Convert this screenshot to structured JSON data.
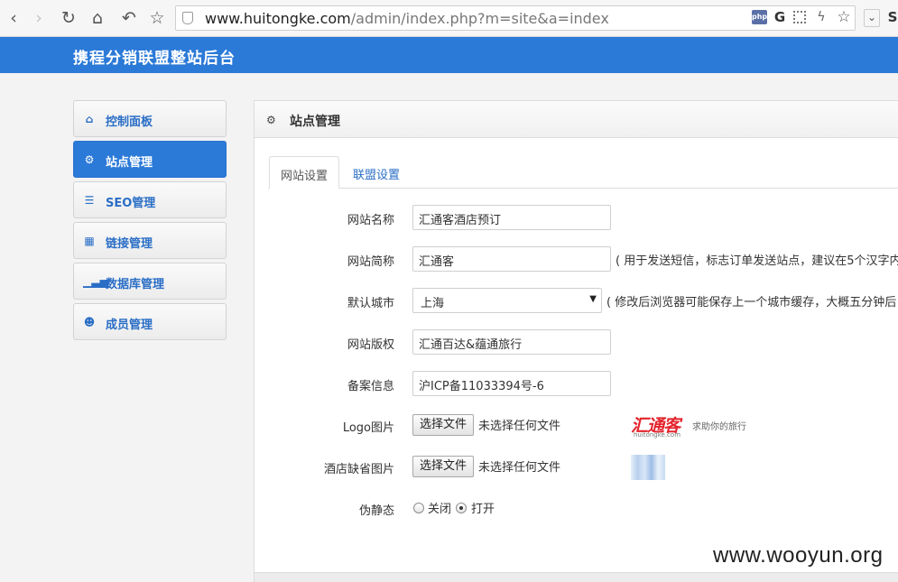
{
  "browser": {
    "url_host": "www.huitongke.com",
    "url_path": "/admin/index.php?m=site&a=index",
    "ext_php": "php",
    "ext_g": "G",
    "ext_s": "S"
  },
  "header": {
    "title": "携程分销联盟整站后台"
  },
  "sidebar": {
    "items": [
      {
        "label": "控制面板",
        "icon": "home-icon",
        "active": false
      },
      {
        "label": "站点管理",
        "icon": "cogs-icon",
        "active": true
      },
      {
        "label": "SEO管理",
        "icon": "list-icon",
        "active": false
      },
      {
        "label": "链接管理",
        "icon": "grid-icon",
        "active": false
      },
      {
        "label": "数据库管理",
        "icon": "signal-icon",
        "active": false
      },
      {
        "label": "成员管理",
        "icon": "user-icon",
        "active": false
      }
    ]
  },
  "panel": {
    "title": "站点管理",
    "tabs": [
      {
        "label": "网站设置",
        "active": true
      },
      {
        "label": "联盟设置",
        "active": false
      }
    ],
    "form": {
      "site_name": {
        "label": "网站名称",
        "value": "汇通客酒店预订"
      },
      "short_name": {
        "label": "网站简称",
        "value": "汇通客",
        "hint": "( 用于发送短信，标志订单发送站点，建议在5个汉字内"
      },
      "default_city": {
        "label": "默认城市",
        "value": "上海",
        "hint": "( 修改后浏览器可能保存上一个城市缓存，大概五分钟后"
      },
      "copyright": {
        "label": "网站版权",
        "value": "汇通百达&蕴通旅行"
      },
      "icp": {
        "label": "备案信息",
        "value": "沪ICP备11033394号-6"
      },
      "logo": {
        "label": "Logo图片",
        "button": "选择文件",
        "status": "未选择任何文件",
        "logo_text": "汇通客",
        "logo_domain": "huitongke.com",
        "logo_slogan": "求助你的旅行"
      },
      "hotel_image": {
        "label": "酒店缺省图片",
        "button": "选择文件",
        "status": "未选择任何文件"
      },
      "rewrite": {
        "label": "伪静态",
        "option_off": "关闭",
        "option_on": "打开",
        "selected": "打开"
      }
    }
  },
  "watermark": "www.wooyun.org",
  "colors": {
    "brand_blue": "#2b7ad8",
    "link_blue": "#2a6ec6",
    "logo_red": "#e4242d"
  }
}
